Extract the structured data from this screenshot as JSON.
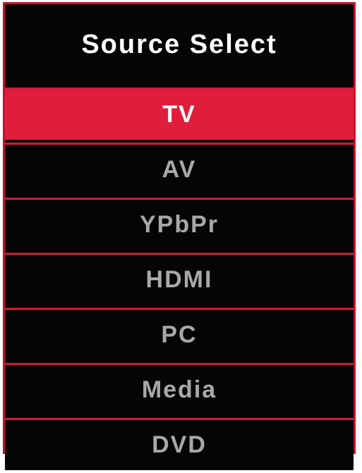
{
  "menu": {
    "title": "Source Select",
    "items": [
      {
        "label": "TV",
        "selected": true
      },
      {
        "label": "AV",
        "selected": false
      },
      {
        "label": "YPbPr",
        "selected": false
      },
      {
        "label": "HDMI",
        "selected": false
      },
      {
        "label": "PC",
        "selected": false
      },
      {
        "label": "Media",
        "selected": false
      },
      {
        "label": "DVD",
        "selected": false
      }
    ]
  },
  "colors": {
    "background": "#050505",
    "accent": "#e11d3c",
    "border": "#c8102e",
    "title_text": "#ffffff",
    "item_text": "#a8a8a8",
    "selected_text": "#ffffff"
  }
}
